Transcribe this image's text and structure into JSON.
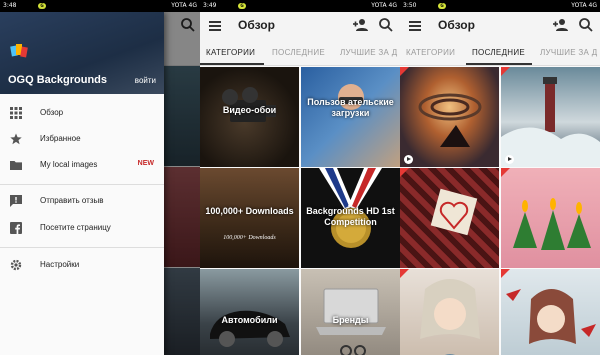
{
  "phone1": {
    "status": {
      "time": "3:48",
      "carrier": "YOTA 4G"
    },
    "drawer": {
      "app_name": "OGQ Backgrounds",
      "login": "войти",
      "items": [
        {
          "label": "Обзор",
          "icon": "grid-icon"
        },
        {
          "label": "Избранное",
          "icon": "star-icon"
        },
        {
          "label": "My local images",
          "icon": "folder-icon",
          "badge": "NEW"
        },
        {
          "label": "Отправить отзыв",
          "icon": "feedback-icon"
        },
        {
          "label": "Посетите страницу",
          "icon": "facebook-icon"
        },
        {
          "label": "Настройки",
          "icon": "settings-icon"
        }
      ]
    }
  },
  "phone2": {
    "status": {
      "time": "3:49",
      "carrier": "YOTA 4G"
    },
    "title": "Обзор",
    "tabs": [
      "КАТЕГОРИИ",
      "ПОСЛЕДНИЕ",
      "ЛУЧШИЕ ЗА Д"
    ],
    "active_tab": 0,
    "categories": [
      {
        "label": "Видео-обои"
      },
      {
        "label": "Пользов ательские загрузки"
      },
      {
        "label": "100,000+ Downloads",
        "sub": "100,000+ Downloads"
      },
      {
        "label": "Backgrounds HD 1st Competition"
      },
      {
        "label": "Автомобили"
      },
      {
        "label": "Бренды"
      }
    ]
  },
  "phone3": {
    "status": {
      "time": "3:50",
      "carrier": "YOTA 4G"
    },
    "title": "Обзор",
    "tabs": [
      "КАТЕГОРИИ",
      "ПОСЛЕДНИЕ",
      "ЛУЧШИЕ ЗА Д"
    ],
    "active_tab": 1
  },
  "colors": {
    "accent_new": "#c62828",
    "header_bg": "#2a3f5e"
  }
}
